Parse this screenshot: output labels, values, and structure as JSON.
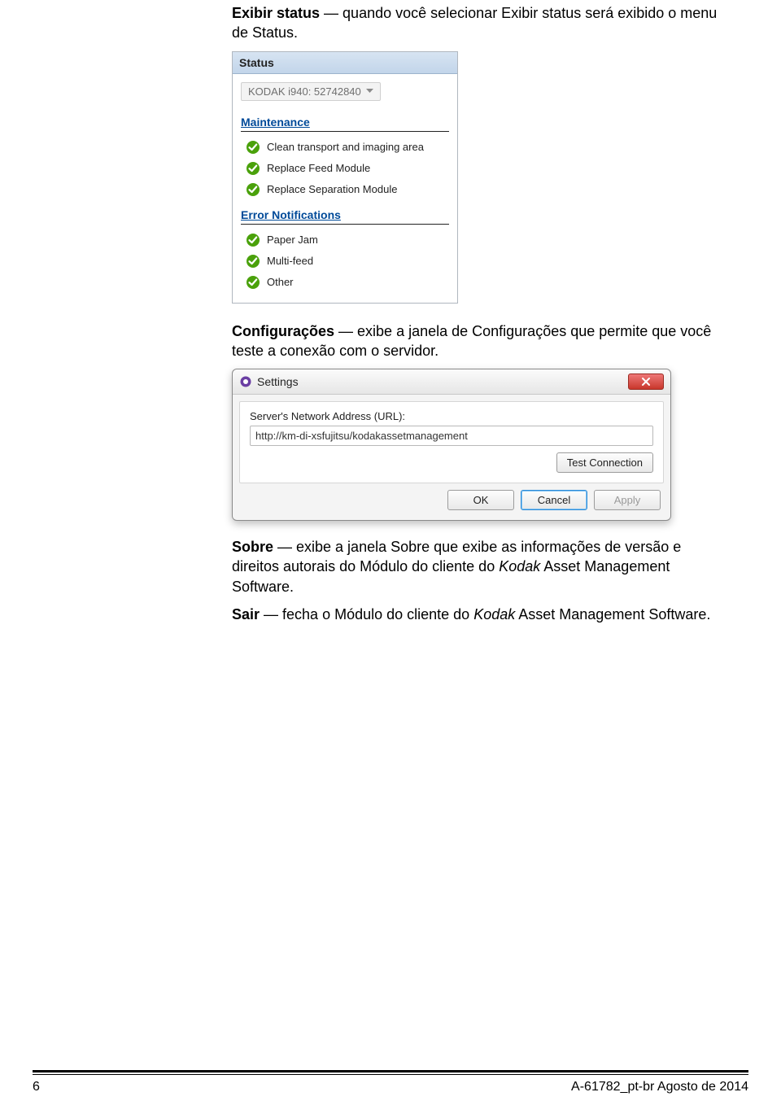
{
  "para1": {
    "bold": "Exibir status",
    "rest": " — quando você selecionar Exibir status será exibido o menu de Status."
  },
  "status_panel": {
    "header": "Status",
    "scanner_value": "KODAK i940: 52742840",
    "maintenance_title": "Maintenance",
    "maintenance_items": [
      "Clean transport and imaging area",
      "Replace Feed Module",
      "Replace Separation Module"
    ],
    "error_title": "Error Notifications",
    "error_items": [
      "Paper Jam",
      "Multi-feed",
      "Other"
    ]
  },
  "para2": {
    "bold": "Configurações",
    "rest": " — exibe a janela de Configurações que permite que você teste a conexão com o servidor."
  },
  "settings_dialog": {
    "title": "Settings",
    "field_label": "Server's Network Address (URL):",
    "url_value": "http://km-di-xsfujitsu/kodakassetmanagement",
    "test_btn": "Test Connection",
    "ok_btn": "OK",
    "cancel_btn": "Cancel",
    "apply_btn": "Apply"
  },
  "para3": {
    "bold": "Sobre",
    "rest_a": " — exibe a janela Sobre que exibe as informações de versão e direitos autorais do Módulo do cliente do ",
    "italic": "Kodak",
    "rest_b": " Asset Management Software."
  },
  "para4": {
    "bold": "Sair",
    "rest_a": " — fecha o Módulo do cliente do ",
    "italic": "Kodak",
    "rest_b": " Asset Management Software."
  },
  "footer": {
    "page_number": "6",
    "doc_id": "A-61782_pt-br  Agosto de 2014"
  }
}
